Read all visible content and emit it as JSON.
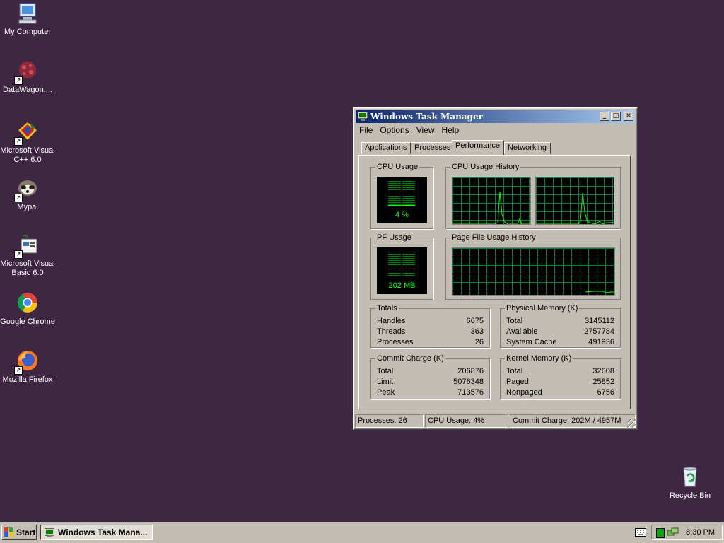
{
  "desktop": {
    "icons": [
      {
        "label": "My Computer",
        "icon": "my-computer-icon"
      },
      {
        "label": "DataWagon....",
        "icon": "datawagon-icon"
      },
      {
        "label": "Microsoft Visual C++ 6.0",
        "icon": "visual-cpp-icon"
      },
      {
        "label": "Mypal",
        "icon": "mypal-icon"
      },
      {
        "label": "Microsoft Visual Basic 6.0",
        "icon": "visual-basic-icon"
      },
      {
        "label": "Google Chrome",
        "icon": "chrome-icon"
      },
      {
        "label": "Mozilla Firefox",
        "icon": "firefox-icon"
      },
      {
        "label": "Recycle Bin",
        "icon": "recycle-bin-icon"
      }
    ]
  },
  "window": {
    "title": "Windows Task Manager",
    "menu": [
      "File",
      "Options",
      "View",
      "Help"
    ],
    "tabs": [
      "Applications",
      "Processes",
      "Performance",
      "Networking"
    ],
    "active_tab": "Performance",
    "cpu_usage": {
      "title": "CPU Usage",
      "value": "4 %",
      "percent": 4
    },
    "cpu_history": {
      "title": "CPU Usage History"
    },
    "pf_usage": {
      "title": "PF Usage",
      "value": "202 MB"
    },
    "pf_history": {
      "title": "Page File Usage History"
    },
    "totals": {
      "title": "Totals",
      "rows": [
        {
          "label": "Handles",
          "value": "6675"
        },
        {
          "label": "Threads",
          "value": "363"
        },
        {
          "label": "Processes",
          "value": "26"
        }
      ]
    },
    "physical_memory": {
      "title": "Physical Memory (K)",
      "rows": [
        {
          "label": "Total",
          "value": "3145112"
        },
        {
          "label": "Available",
          "value": "2757784"
        },
        {
          "label": "System Cache",
          "value": "491936"
        }
      ]
    },
    "commit_charge": {
      "title": "Commit Charge (K)",
      "rows": [
        {
          "label": "Total",
          "value": "206876"
        },
        {
          "label": "Limit",
          "value": "5076348"
        },
        {
          "label": "Peak",
          "value": "713576"
        }
      ]
    },
    "kernel_memory": {
      "title": "Kernel Memory (K)",
      "rows": [
        {
          "label": "Total",
          "value": "32608"
        },
        {
          "label": "Paged",
          "value": "25852"
        },
        {
          "label": "Nonpaged",
          "value": "6756"
        }
      ]
    },
    "status": {
      "processes": "Processes: 26",
      "cpu": "CPU Usage: 4%",
      "commit": "Commit Charge: 202M / 4957M"
    }
  },
  "taskbar": {
    "start_label": "Start",
    "task_label": "Windows Task Mana...",
    "clock": "8:30 PM"
  },
  "colors": {
    "desktop": "#3f2743",
    "graph_line": "#00ff00",
    "grid": "#007f3f",
    "title_start": "#0a246a",
    "title_end": "#a6caf0"
  }
}
